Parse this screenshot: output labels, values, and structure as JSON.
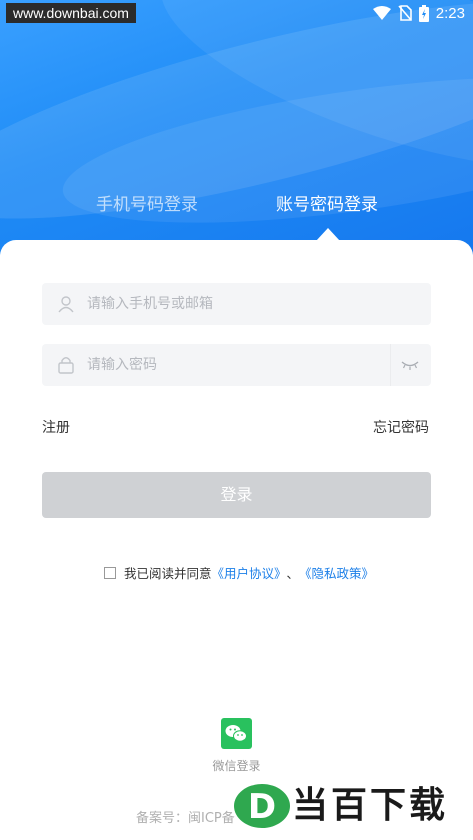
{
  "status_bar": {
    "watermark": "www.downbai.com",
    "time": "2:23"
  },
  "tabs": {
    "phone_login": "手机号码登录",
    "account_login": "账号密码登录"
  },
  "form": {
    "username_placeholder": "请输入手机号或邮箱",
    "password_placeholder": "请输入密码",
    "register_label": "注册",
    "forgot_label": "忘记密码",
    "login_button": "登录"
  },
  "agreement": {
    "prefix": "我已阅读并同意",
    "user_agreement": "《用户协议》",
    "separator": "、",
    "privacy_policy": "《隐私政策》"
  },
  "wechat_login": "微信登录",
  "footer": {
    "icp": "备案号：闽ICP备",
    "brand_text": "当百下载"
  },
  "colors": {
    "primary_blue": "#1f8cf6",
    "link_blue": "#1c7fe8",
    "button_disabled": "#cfd1d4",
    "wechat_green": "#29c15e"
  },
  "icons": [
    "wifi-icon",
    "no-sim-icon",
    "battery-icon",
    "user-icon",
    "lock-icon",
    "eye-closed-icon",
    "wechat-icon"
  ]
}
